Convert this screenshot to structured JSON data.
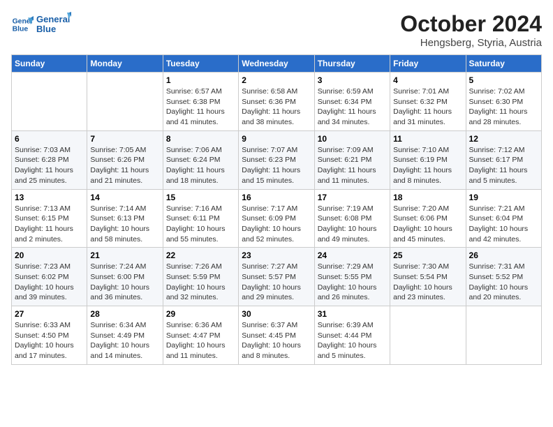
{
  "logo": {
    "line1": "General",
    "line2": "Blue"
  },
  "title": "October 2024",
  "subtitle": "Hengsberg, Styria, Austria",
  "days_of_week": [
    "Sunday",
    "Monday",
    "Tuesday",
    "Wednesday",
    "Thursday",
    "Friday",
    "Saturday"
  ],
  "weeks": [
    [
      {
        "day": null,
        "info": null
      },
      {
        "day": null,
        "info": null
      },
      {
        "day": "1",
        "sunrise": "6:57 AM",
        "sunset": "6:38 PM",
        "daylight": "11 hours and 41 minutes."
      },
      {
        "day": "2",
        "sunrise": "6:58 AM",
        "sunset": "6:36 PM",
        "daylight": "11 hours and 38 minutes."
      },
      {
        "day": "3",
        "sunrise": "6:59 AM",
        "sunset": "6:34 PM",
        "daylight": "11 hours and 34 minutes."
      },
      {
        "day": "4",
        "sunrise": "7:01 AM",
        "sunset": "6:32 PM",
        "daylight": "11 hours and 31 minutes."
      },
      {
        "day": "5",
        "sunrise": "7:02 AM",
        "sunset": "6:30 PM",
        "daylight": "11 hours and 28 minutes."
      }
    ],
    [
      {
        "day": "6",
        "sunrise": "7:03 AM",
        "sunset": "6:28 PM",
        "daylight": "11 hours and 25 minutes."
      },
      {
        "day": "7",
        "sunrise": "7:05 AM",
        "sunset": "6:26 PM",
        "daylight": "11 hours and 21 minutes."
      },
      {
        "day": "8",
        "sunrise": "7:06 AM",
        "sunset": "6:24 PM",
        "daylight": "11 hours and 18 minutes."
      },
      {
        "day": "9",
        "sunrise": "7:07 AM",
        "sunset": "6:23 PM",
        "daylight": "11 hours and 15 minutes."
      },
      {
        "day": "10",
        "sunrise": "7:09 AM",
        "sunset": "6:21 PM",
        "daylight": "11 hours and 11 minutes."
      },
      {
        "day": "11",
        "sunrise": "7:10 AM",
        "sunset": "6:19 PM",
        "daylight": "11 hours and 8 minutes."
      },
      {
        "day": "12",
        "sunrise": "7:12 AM",
        "sunset": "6:17 PM",
        "daylight": "11 hours and 5 minutes."
      }
    ],
    [
      {
        "day": "13",
        "sunrise": "7:13 AM",
        "sunset": "6:15 PM",
        "daylight": "11 hours and 2 minutes."
      },
      {
        "day": "14",
        "sunrise": "7:14 AM",
        "sunset": "6:13 PM",
        "daylight": "10 hours and 58 minutes."
      },
      {
        "day": "15",
        "sunrise": "7:16 AM",
        "sunset": "6:11 PM",
        "daylight": "10 hours and 55 minutes."
      },
      {
        "day": "16",
        "sunrise": "7:17 AM",
        "sunset": "6:09 PM",
        "daylight": "10 hours and 52 minutes."
      },
      {
        "day": "17",
        "sunrise": "7:19 AM",
        "sunset": "6:08 PM",
        "daylight": "10 hours and 49 minutes."
      },
      {
        "day": "18",
        "sunrise": "7:20 AM",
        "sunset": "6:06 PM",
        "daylight": "10 hours and 45 minutes."
      },
      {
        "day": "19",
        "sunrise": "7:21 AM",
        "sunset": "6:04 PM",
        "daylight": "10 hours and 42 minutes."
      }
    ],
    [
      {
        "day": "20",
        "sunrise": "7:23 AM",
        "sunset": "6:02 PM",
        "daylight": "10 hours and 39 minutes."
      },
      {
        "day": "21",
        "sunrise": "7:24 AM",
        "sunset": "6:00 PM",
        "daylight": "10 hours and 36 minutes."
      },
      {
        "day": "22",
        "sunrise": "7:26 AM",
        "sunset": "5:59 PM",
        "daylight": "10 hours and 32 minutes."
      },
      {
        "day": "23",
        "sunrise": "7:27 AM",
        "sunset": "5:57 PM",
        "daylight": "10 hours and 29 minutes."
      },
      {
        "day": "24",
        "sunrise": "7:29 AM",
        "sunset": "5:55 PM",
        "daylight": "10 hours and 26 minutes."
      },
      {
        "day": "25",
        "sunrise": "7:30 AM",
        "sunset": "5:54 PM",
        "daylight": "10 hours and 23 minutes."
      },
      {
        "day": "26",
        "sunrise": "7:31 AM",
        "sunset": "5:52 PM",
        "daylight": "10 hours and 20 minutes."
      }
    ],
    [
      {
        "day": "27",
        "sunrise": "6:33 AM",
        "sunset": "4:50 PM",
        "daylight": "10 hours and 17 minutes."
      },
      {
        "day": "28",
        "sunrise": "6:34 AM",
        "sunset": "4:49 PM",
        "daylight": "10 hours and 14 minutes."
      },
      {
        "day": "29",
        "sunrise": "6:36 AM",
        "sunset": "4:47 PM",
        "daylight": "10 hours and 11 minutes."
      },
      {
        "day": "30",
        "sunrise": "6:37 AM",
        "sunset": "4:45 PM",
        "daylight": "10 hours and 8 minutes."
      },
      {
        "day": "31",
        "sunrise": "6:39 AM",
        "sunset": "4:44 PM",
        "daylight": "10 hours and 5 minutes."
      },
      {
        "day": null,
        "info": null
      },
      {
        "day": null,
        "info": null
      }
    ]
  ],
  "labels": {
    "sunrise": "Sunrise:",
    "sunset": "Sunset:",
    "daylight": "Daylight:"
  }
}
